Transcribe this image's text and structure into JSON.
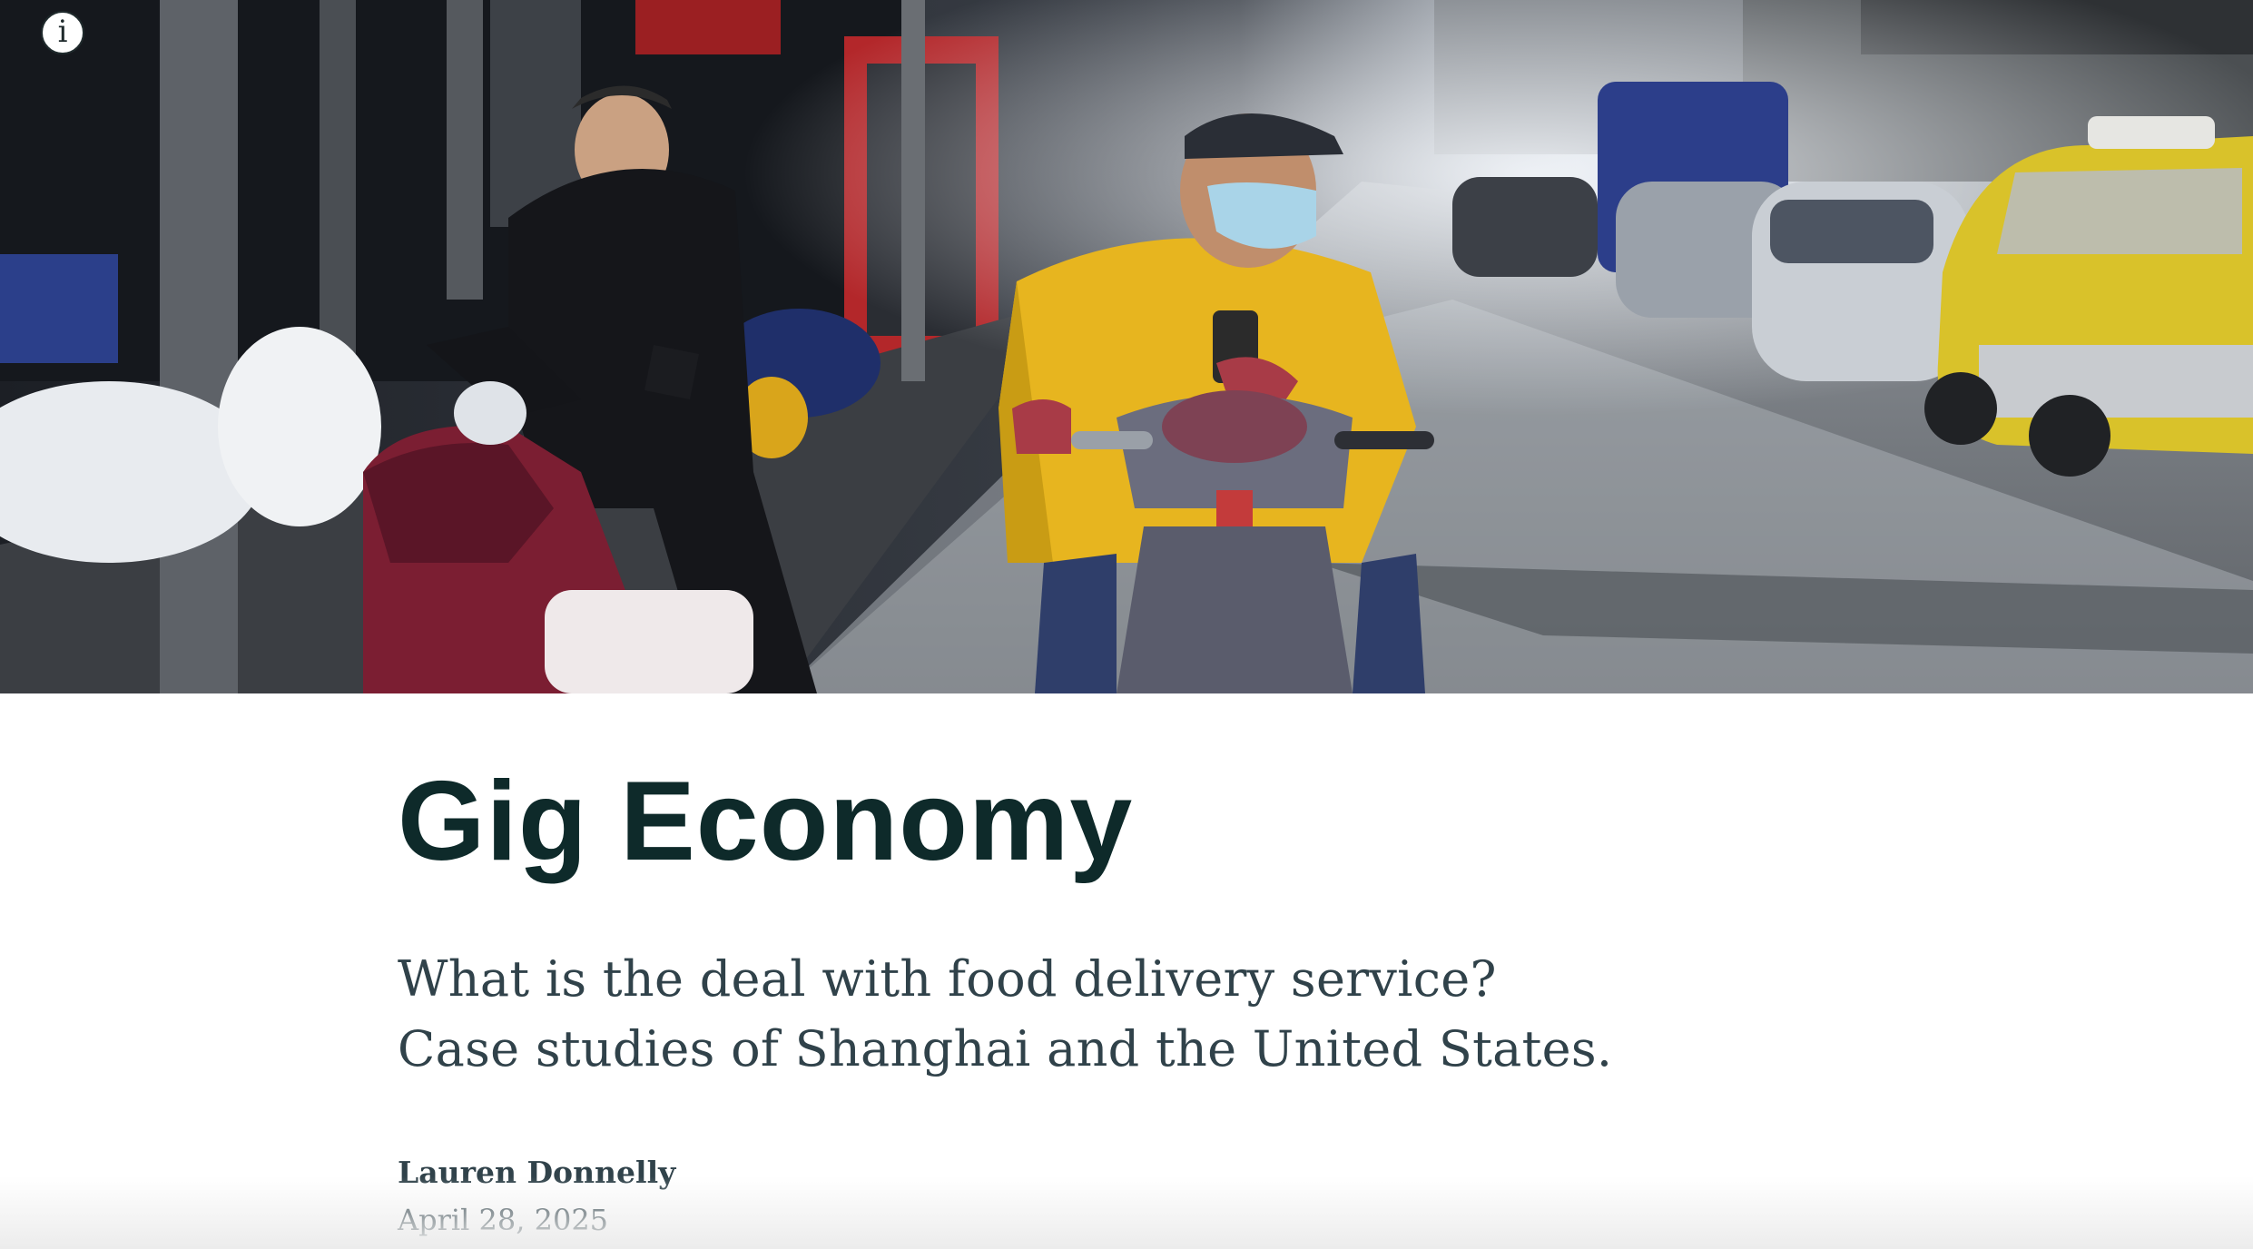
{
  "hero": {
    "info_icon": "info-icon",
    "info_glyph": "i"
  },
  "article": {
    "title": "Gig Economy",
    "subtitle_line1": "What is the deal with food delivery service?",
    "subtitle_line2": "Case studies of Shanghai and the United States.",
    "author": "Lauren Donnelly",
    "date": "April 28, 2025"
  },
  "colors": {
    "title": "#0e2a2a",
    "body_text": "#30424a",
    "rider_jacket": "#e7b51f",
    "taxi": "#d9c22a"
  }
}
